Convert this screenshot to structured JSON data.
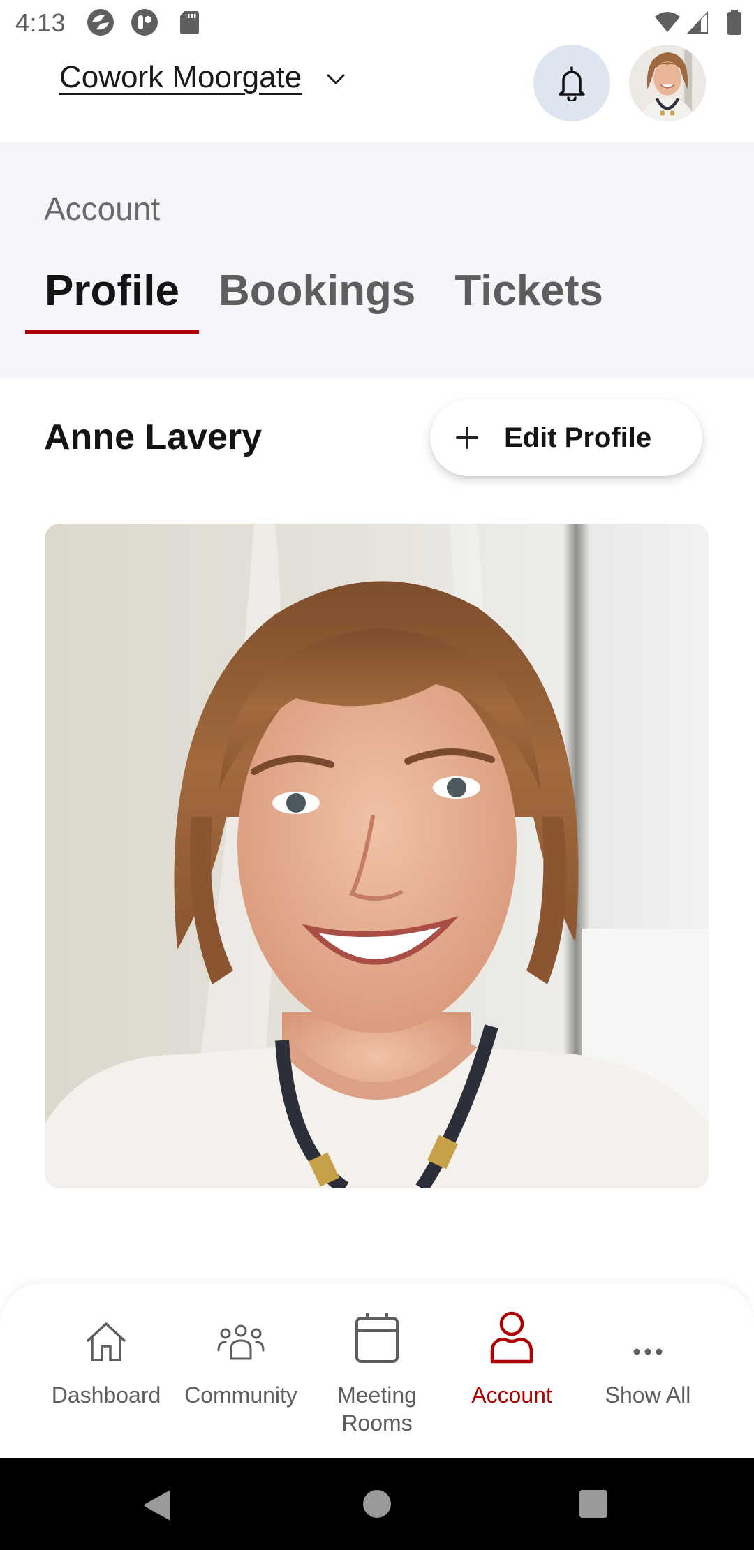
{
  "status_bar": {
    "time": "4:13",
    "left_icons": [
      "sync-app-icon",
      "app-notification-icon",
      "sd-card-icon"
    ],
    "right_icons": [
      "wifi-icon",
      "cell-signal-icon",
      "battery-icon"
    ]
  },
  "header": {
    "location": "Cowork Moorgate",
    "location_dropdown_icon": "chevron-down-icon",
    "notifications_icon": "bell-icon",
    "avatar_alt": "Anne Lavery"
  },
  "account": {
    "section_label": "Account",
    "tabs": [
      {
        "label": "Profile",
        "active": true
      },
      {
        "label": "Bookings",
        "active": false
      },
      {
        "label": "Tickets",
        "active": false
      }
    ]
  },
  "profile": {
    "name": "Anne Lavery",
    "edit_button_label": "Edit Profile",
    "edit_button_icon": "plus-icon",
    "photo_alt": "Anne Lavery profile photo"
  },
  "bottom_nav": {
    "items": [
      {
        "label": "Dashboard",
        "icon": "home-icon",
        "active": false
      },
      {
        "label": "Community",
        "icon": "people-icon",
        "active": false
      },
      {
        "label": "Meeting Rooms",
        "icon": "calendar-icon",
        "active": false
      },
      {
        "label": "Account",
        "icon": "user-icon",
        "active": true
      },
      {
        "label": "Show All",
        "icon": "more-horizontal-icon",
        "active": false
      }
    ]
  },
  "colors": {
    "accent": "#b00000",
    "section_bg": "#f4f6f9",
    "bell_bg": "#dfe5f0",
    "inactive_text": "#5e5e5e"
  }
}
